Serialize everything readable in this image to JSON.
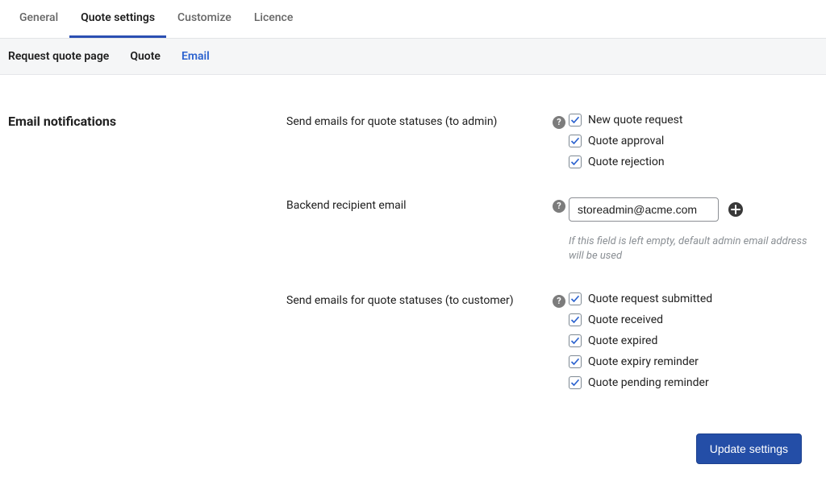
{
  "tabs": {
    "general": "General",
    "quote_settings": "Quote settings",
    "customize": "Customize",
    "licence": "Licence"
  },
  "subnav": {
    "request_quote_page": "Request quote page",
    "quote": "Quote",
    "email": "Email"
  },
  "section_title": "Email notifications",
  "rows": {
    "admin": {
      "label": "Send emails for quote statuses (to admin)",
      "options": {
        "new_quote_request": "New quote request",
        "quote_approval": "Quote approval",
        "quote_rejection": "Quote rejection"
      }
    },
    "recipient": {
      "label": "Backend recipient email",
      "value": "storeadmin@acme.com",
      "hint": "If this field is left empty, default admin email address will be used"
    },
    "customer": {
      "label": "Send emails for quote statuses (to customer)",
      "options": {
        "submitted": "Quote request submitted",
        "received": "Quote received",
        "expired": "Quote expired",
        "expiry_reminder": "Quote expiry reminder",
        "pending_reminder": "Quote pending reminder"
      }
    }
  },
  "buttons": {
    "update": "Update settings"
  }
}
